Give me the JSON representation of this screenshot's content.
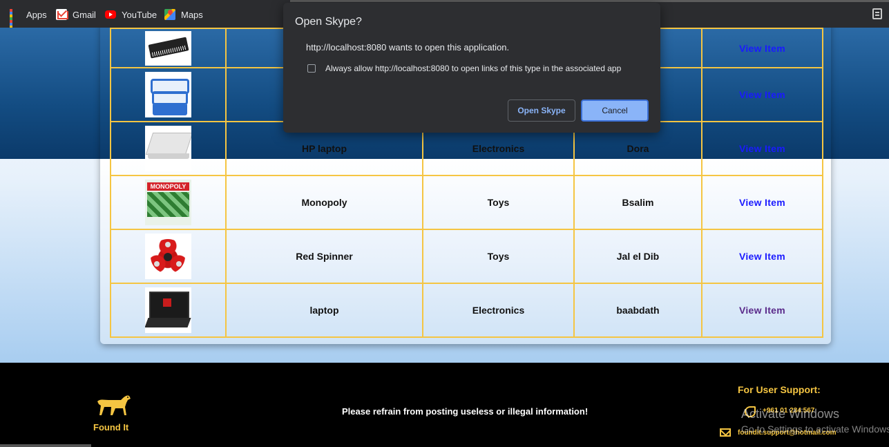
{
  "bookmarks": {
    "items": [
      {
        "label": "Apps",
        "icon": "apps-grid-icon"
      },
      {
        "label": "Gmail",
        "icon": "gmail-icon"
      },
      {
        "label": "YouTube",
        "icon": "youtube-icon"
      },
      {
        "label": "Maps",
        "icon": "maps-icon"
      }
    ]
  },
  "dialog": {
    "title": "Open Skype?",
    "message": "http://localhost:8080 wants to open this application.",
    "checkbox_label": "Always allow http://localhost:8080 to open links of this type in the associated app",
    "checkbox_checked": false,
    "open_button": "Open Skype",
    "cancel_button": "Cancel"
  },
  "table": {
    "rows": [
      {
        "image": "comb",
        "name": "",
        "category": "",
        "location": "",
        "action": "View Item"
      },
      {
        "image": "food-containers",
        "name": "",
        "category": "",
        "location": "",
        "action": "View Item"
      },
      {
        "image": "hp-laptop",
        "name": "HP laptop",
        "category": "Electronics",
        "location": "Dora",
        "action": "View Item"
      },
      {
        "image": "monopoly",
        "name": "Monopoly",
        "category": "Toys",
        "location": "Bsalim",
        "action": "View Item"
      },
      {
        "image": "red-spinner",
        "name": "Red Spinner",
        "category": "Toys",
        "location": "Jal el Dib",
        "action": "View Item"
      },
      {
        "image": "laptop",
        "name": "laptop",
        "category": "Electronics",
        "location": "baabdath",
        "action": "View Item"
      }
    ]
  },
  "footer": {
    "brand": "Found It",
    "disclaimer": "Please refrain from posting useless or illegal information!",
    "support_title": "For User Support:",
    "phone": "+961 01 234 567",
    "email": "foundit.support@hotmail.com"
  },
  "watermark": {
    "line1": "Activate Windows",
    "line2": "Go to Settings to activate Windows."
  },
  "colors": {
    "accent_gold": "#f5c542",
    "link_blue": "#1a1aff",
    "visited_purple": "#5a2a8a",
    "dialog_bg": "#2d2e31",
    "dialog_primary": "#8ab4f8"
  }
}
